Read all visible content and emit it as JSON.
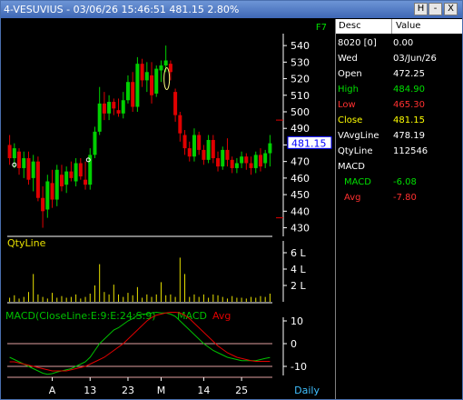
{
  "window": {
    "title": "4-VESUVIUS - 03/06/26 15:46:51 481.15 2.80%",
    "help_label": "H",
    "minimize_label": "-",
    "close_label": "X"
  },
  "chart": {
    "key_label": "F7",
    "price_axis_ticks": [
      "540",
      "530",
      "520",
      "510",
      "500",
      "490",
      "480",
      "470",
      "460",
      "450",
      "440",
      "430"
    ],
    "current_price_tag": "481.15",
    "qty_title": "QtyLine",
    "qty_axis_ticks": [
      "6 L",
      "4 L",
      "2 L"
    ],
    "macd_title": "MACD(CloseLine:E:9:E:24:S:9)",
    "macd_legend_macd": "MACD",
    "macd_legend_avg": "Avg",
    "macd_axis_ticks": [
      "10",
      "0",
      "-10"
    ],
    "x_axis_ticks": [
      "A",
      "13",
      "23",
      "M",
      "14",
      "25"
    ],
    "period_label": "Daily",
    "colors": {
      "up": "#00d000",
      "down": "#e00000",
      "macd_line": "#00c000",
      "avg_line": "#e00000",
      "qty_bars": "#e8e000",
      "axis": "#ffffff",
      "highlight_tag": "#0000ff"
    }
  },
  "chart_data": [
    {
      "type": "candlestick",
      "title": "4-VESUVIUS",
      "ylim": [
        427,
        545
      ],
      "x_ticks": [
        "A",
        "13",
        "23",
        "M",
        "14",
        "25"
      ],
      "candles": [
        {
          "o": 480,
          "h": 486,
          "l": 468,
          "c": 472
        },
        {
          "o": 472,
          "h": 481,
          "l": 466,
          "c": 478
        },
        {
          "o": 476,
          "h": 478,
          "l": 462,
          "c": 466
        },
        {
          "o": 466,
          "h": 476,
          "l": 460,
          "c": 472
        },
        {
          "o": 472,
          "h": 476,
          "l": 456,
          "c": 459
        },
        {
          "o": 460,
          "h": 474,
          "l": 452,
          "c": 470
        },
        {
          "o": 470,
          "h": 473,
          "l": 446,
          "c": 448
        },
        {
          "o": 448,
          "h": 455,
          "l": 430,
          "c": 440
        },
        {
          "o": 441,
          "h": 462,
          "l": 436,
          "c": 458
        },
        {
          "o": 457,
          "h": 465,
          "l": 442,
          "c": 447
        },
        {
          "o": 447,
          "h": 468,
          "l": 443,
          "c": 465
        },
        {
          "o": 462,
          "h": 468,
          "l": 452,
          "c": 455
        },
        {
          "o": 456,
          "h": 467,
          "l": 451,
          "c": 464
        },
        {
          "o": 464,
          "h": 470,
          "l": 458,
          "c": 460
        },
        {
          "o": 458,
          "h": 472,
          "l": 455,
          "c": 469
        },
        {
          "o": 469,
          "h": 472,
          "l": 459,
          "c": 461
        },
        {
          "o": 459,
          "h": 470,
          "l": 453,
          "c": 456
        },
        {
          "o": 456,
          "h": 478,
          "l": 453,
          "c": 474
        },
        {
          "o": 474,
          "h": 491,
          "l": 472,
          "c": 488
        },
        {
          "o": 488,
          "h": 515,
          "l": 486,
          "c": 505
        },
        {
          "o": 505,
          "h": 512,
          "l": 495,
          "c": 499
        },
        {
          "o": 499,
          "h": 510,
          "l": 495,
          "c": 506
        },
        {
          "o": 506,
          "h": 508,
          "l": 498,
          "c": 502
        },
        {
          "o": 501,
          "h": 508,
          "l": 497,
          "c": 499
        },
        {
          "o": 499,
          "h": 512,
          "l": 496,
          "c": 507
        },
        {
          "o": 507,
          "h": 522,
          "l": 505,
          "c": 518
        },
        {
          "o": 518,
          "h": 524,
          "l": 500,
          "c": 503
        },
        {
          "o": 503,
          "h": 533,
          "l": 500,
          "c": 529
        },
        {
          "o": 529,
          "h": 532,
          "l": 515,
          "c": 519
        },
        {
          "o": 519,
          "h": 530,
          "l": 512,
          "c": 524
        },
        {
          "o": 522,
          "h": 530,
          "l": 505,
          "c": 510
        },
        {
          "o": 511,
          "h": 528,
          "l": 509,
          "c": 526
        },
        {
          "o": 525,
          "h": 531,
          "l": 518,
          "c": 528
        },
        {
          "o": 528,
          "h": 540,
          "l": 524,
          "c": 531
        },
        {
          "o": 529,
          "h": 531,
          "l": 519,
          "c": 524
        },
        {
          "o": 512,
          "h": 514,
          "l": 494,
          "c": 498
        },
        {
          "o": 498,
          "h": 500,
          "l": 482,
          "c": 487
        },
        {
          "o": 486,
          "h": 489,
          "l": 474,
          "c": 478
        },
        {
          "o": 478,
          "h": 482,
          "l": 470,
          "c": 473
        },
        {
          "o": 473,
          "h": 490,
          "l": 470,
          "c": 486
        },
        {
          "o": 486,
          "h": 488,
          "l": 474,
          "c": 477
        },
        {
          "o": 477,
          "h": 480,
          "l": 468,
          "c": 471
        },
        {
          "o": 471,
          "h": 486,
          "l": 469,
          "c": 483
        },
        {
          "o": 483,
          "h": 486,
          "l": 469,
          "c": 472
        },
        {
          "o": 472,
          "h": 476,
          "l": 464,
          "c": 467
        },
        {
          "o": 467,
          "h": 479,
          "l": 465,
          "c": 477
        },
        {
          "o": 477,
          "h": 484,
          "l": 467,
          "c": 471
        },
        {
          "o": 471,
          "h": 473,
          "l": 463,
          "c": 466
        },
        {
          "o": 466,
          "h": 472,
          "l": 463,
          "c": 469
        },
        {
          "o": 469,
          "h": 476,
          "l": 466,
          "c": 473
        },
        {
          "o": 473,
          "h": 475,
          "l": 465,
          "c": 469
        },
        {
          "o": 469,
          "h": 473,
          "l": 462,
          "c": 466
        },
        {
          "o": 466,
          "h": 476,
          "l": 463,
          "c": 474
        },
        {
          "o": 474,
          "h": 478,
          "l": 464,
          "c": 467
        },
        {
          "o": 469,
          "h": 477,
          "l": 466,
          "c": 475
        },
        {
          "o": 475,
          "h": 486,
          "l": 467,
          "c": 481
        }
      ],
      "current_price": 481.15
    },
    {
      "type": "bar",
      "title": "QtyLine",
      "ylim": [
        0,
        7
      ],
      "values": [
        0.5,
        0.8,
        0.4,
        0.6,
        1.2,
        3.4,
        0.9,
        0.6,
        0.4,
        1.1,
        0.5,
        0.7,
        0.5,
        0.6,
        0.9,
        0.4,
        0.6,
        1.0,
        2.0,
        4.6,
        1.2,
        0.9,
        2.1,
        0.9,
        0.6,
        1.1,
        0.8,
        1.8,
        0.5,
        0.9,
        0.6,
        0.9,
        2.4,
        0.8,
        0.9,
        0.6,
        5.4,
        3.4,
        0.6,
        0.9,
        0.6,
        0.9,
        0.5,
        0.9,
        0.8,
        0.6,
        0.4,
        0.7,
        0.5,
        0.5,
        0.4,
        0.6,
        0.5,
        0.7,
        0.6,
        1.0
      ]
    },
    {
      "type": "line",
      "title": "MACD(CloseLine:E:9:E:24:S:9)",
      "ylim": [
        -14,
        14
      ],
      "series": [
        {
          "name": "MACD",
          "values": [
            -6,
            -7,
            -8,
            -9,
            -10,
            -11,
            -12,
            -13,
            -13.5,
            -13.2,
            -12.5,
            -12,
            -11.5,
            -11,
            -10,
            -9,
            -8,
            -6,
            -3,
            0,
            2,
            4,
            6,
            7,
            8.5,
            10,
            11,
            12.5,
            13,
            13,
            13.5,
            13.8,
            13.5,
            13.5,
            13,
            12,
            10,
            8,
            6,
            4,
            2,
            0,
            -1.5,
            -3,
            -4,
            -5,
            -6,
            -6.5,
            -7,
            -7.5,
            -7.5,
            -7.5,
            -7.5,
            -7,
            -6.5,
            -6.08
          ]
        },
        {
          "name": "Avg",
          "values": [
            -8,
            -8,
            -8.5,
            -9,
            -9.5,
            -10,
            -10.5,
            -11,
            -11.5,
            -12,
            -12,
            -12,
            -12,
            -11.5,
            -11,
            -10.5,
            -10,
            -9,
            -8,
            -7,
            -6,
            -4.5,
            -3,
            -1.5,
            0,
            2,
            4,
            6,
            8,
            10,
            11.5,
            12.5,
            13,
            13.5,
            13.8,
            13.8,
            13.5,
            12.5,
            11,
            9,
            7,
            5,
            3,
            1,
            -1,
            -2.5,
            -4,
            -5,
            -6,
            -6.5,
            -7,
            -7.5,
            -7.8,
            -7.8,
            -7.8,
            -7.8
          ]
        }
      ],
      "reference_lines": [
        0,
        -10
      ]
    }
  ],
  "panel": {
    "header_desc": "Desc",
    "header_value": "Value",
    "rows": [
      {
        "label": "8020 [0]",
        "value": "0.00",
        "color": "#ffffff"
      },
      {
        "label": "Wed",
        "value": "03/Jun/26",
        "color": "#ffffff"
      },
      {
        "label": "Open",
        "value": "472.25",
        "color": "#ffffff"
      },
      {
        "label": "High",
        "value": "484.90",
        "color": "#00e000"
      },
      {
        "label": "Low",
        "value": "465.30",
        "color": "#ff3030"
      },
      {
        "label": "Close",
        "value": "481.15",
        "color": "#ffff00"
      },
      {
        "label": "VAvgLine",
        "value": "478.19",
        "color": "#ffffff"
      },
      {
        "label": "QtyLine",
        "value": "112546",
        "color": "#ffffff"
      },
      {
        "label": "MACD",
        "value": "",
        "color": "#ffffff"
      },
      {
        "label": "MACD",
        "value": "-6.08",
        "color": "#00e000",
        "indent": true
      },
      {
        "label": "Avg",
        "value": "-7.80",
        "color": "#ff3030",
        "indent": true
      }
    ]
  }
}
